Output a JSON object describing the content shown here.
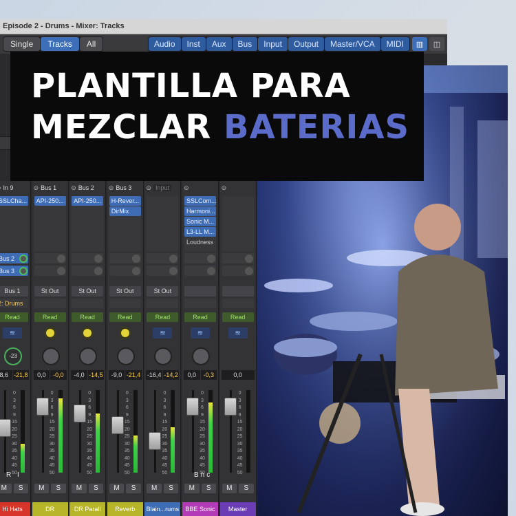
{
  "window": {
    "title": "Episode 2 - Drums - Mixer: Tracks"
  },
  "toolbar": {
    "view_modes": [
      "Single",
      "Tracks",
      "All"
    ],
    "active_view": "Tracks",
    "filters": [
      "Audio",
      "Inst",
      "Aux",
      "Bus",
      "Input",
      "Output",
      "Master/VCA",
      "MIDI"
    ]
  },
  "overlay": {
    "line1": "PLANTILLA PARA",
    "line2_plain": "MEZCLAR",
    "line2_accent": "BATERIAS",
    "accent_color": "#5b6bc9"
  },
  "strips": [
    {
      "name": "Hi Hats",
      "color": "#d7342a",
      "input": "In 9",
      "plugins": [
        "SSLCha..."
      ],
      "sends": [
        "Bus 2",
        "Bus 3"
      ],
      "output": "Bus 1",
      "group": "2: Drums",
      "automation": "Read",
      "eq": "blue",
      "pan": "-23",
      "vals": [
        "8,6",
        "-21,8"
      ],
      "ri": "R I",
      "level_pct": 0.55,
      "meter_pct": 0.35
    },
    {
      "name": "DR",
      "color": "#b7b52a",
      "input": "Bus 1",
      "plugins": [
        "API-250..."
      ],
      "sends": [],
      "output": "St Out",
      "group": "",
      "automation": "Read",
      "eq": "yellow",
      "pan": "",
      "vals": [
        "0,0",
        "-0,0"
      ],
      "ri": "",
      "level_pct": 0.88,
      "meter_pct": 0.9
    },
    {
      "name": "DR Parall",
      "color": "#b7b52a",
      "input": "Bus 2",
      "plugins": [
        "API-250..."
      ],
      "sends": [],
      "output": "St Out",
      "group": "",
      "automation": "Read",
      "eq": "yellow",
      "pan": "",
      "vals": [
        "-4,0",
        "-14,5"
      ],
      "ri": "",
      "level_pct": 0.78,
      "meter_pct": 0.72
    },
    {
      "name": "Reverb",
      "color": "#b7b52a",
      "input": "Bus 3",
      "plugins": [
        "H-Rever...",
        "DirMix"
      ],
      "sends": [],
      "output": "St Out",
      "group": "",
      "automation": "Read",
      "eq": "yellow",
      "pan": "",
      "vals": [
        "-9,0",
        "-21,4"
      ],
      "ri": "",
      "level_pct": 0.6,
      "meter_pct": 0.45
    },
    {
      "name": "Blain...rums",
      "color": "#3f6db5",
      "input": "Input",
      "plugins": [],
      "sends": [],
      "output": "St Out",
      "group": "",
      "automation": "Read",
      "eq": "blue",
      "pan": "",
      "vals": [
        "-16,4",
        "-14,2"
      ],
      "ri": "",
      "level_pct": 0.35,
      "meter_pct": 0.55
    },
    {
      "name": "BBE Sonic",
      "color": "#b33bb7",
      "input": "",
      "plugins": [
        "SSLCom...",
        "Harmoni...",
        "Sonic M...",
        "L3-LL M...",
        "Loudness"
      ],
      "sends": [],
      "output": "",
      "group": "",
      "automation": "Read",
      "eq": "blue",
      "pan": "",
      "vals": [
        "0,0",
        "-0,3"
      ],
      "ri": "Bnc",
      "level_pct": 0.88,
      "meter_pct": 0.85
    },
    {
      "name": "Master",
      "color": "#6b3db5",
      "input": "",
      "plugins": [],
      "sends": [],
      "output": "",
      "group": "",
      "automation": "Read",
      "eq": "blue",
      "pan": "",
      "vals": [
        "0,0"
      ],
      "ri": "",
      "level_pct": 0.88,
      "meter_pct": 0
    }
  ],
  "fader_scale": [
    "0",
    "3",
    "6",
    "9",
    "15",
    "20",
    "25",
    "30",
    "35",
    "40",
    "45",
    "50"
  ],
  "ms_labels": [
    "M",
    "S"
  ]
}
